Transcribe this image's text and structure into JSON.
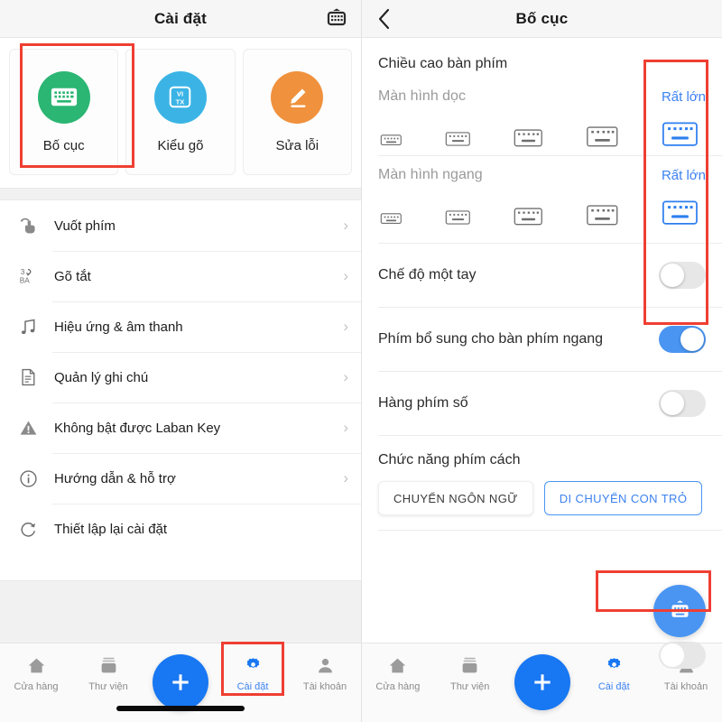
{
  "left_panel": {
    "header": {
      "title": "Cài đặt",
      "right_icon": "keyboard-popup-icon"
    },
    "cards": [
      {
        "label": "Bố cục",
        "icon": "keyboard-icon",
        "color": "#2BB673",
        "selected": true
      },
      {
        "label": "Kiểu gõ",
        "icon": "vi-tx-icon",
        "color": "#3BB4E5",
        "selected": false
      },
      {
        "label": "Sửa lỗi",
        "icon": "pencil-icon",
        "color": "#F0913D",
        "selected": false
      }
    ],
    "list": [
      {
        "label": "Vuốt phím",
        "icon": "swipe-hand-icon"
      },
      {
        "label": "Gõ tắt",
        "icon": "shortcut-3ba-icon"
      },
      {
        "label": "Hiệu ứng & âm thanh",
        "icon": "music-note-icon"
      },
      {
        "label": "Quản lý ghi chú",
        "icon": "note-document-icon"
      },
      {
        "label": "Không bật được Laban Key",
        "icon": "warning-triangle-icon"
      },
      {
        "label": "Hướng dẫn & hỗ trợ",
        "icon": "info-circle-icon"
      },
      {
        "label": "Thiết lập lại cài đặt",
        "icon": "reset-refresh-icon"
      }
    ],
    "tabbar": {
      "tabs": [
        {
          "label": "Cửa hàng",
          "icon": "home-icon",
          "active": false
        },
        {
          "label": "Thư viện",
          "icon": "library-icon",
          "active": false
        },
        {
          "label": "Cài đặt",
          "icon": "gear-icon",
          "active": true
        },
        {
          "label": "Tài khoản",
          "icon": "person-icon",
          "active": false
        }
      ],
      "fab_label": "+",
      "fab_icon": "plus-icon"
    }
  },
  "right_panel": {
    "header": {
      "title": "Bố cục",
      "back_icon": "chevron-left-icon"
    },
    "section_title": "Chiều cao bàn phím",
    "height_groups": [
      {
        "label": "Màn hình dọc",
        "value": "Rất lớn",
        "options": 5,
        "selected_index": 4
      },
      {
        "label": "Màn hình ngang",
        "value": "Rất lớn",
        "options": 5,
        "selected_index": 4
      }
    ],
    "switches": [
      {
        "label": "Chế độ một tay",
        "on": false
      },
      {
        "label": "Phím bổ sung cho bàn phím ngang",
        "on": true
      },
      {
        "label": "Hàng phím số",
        "on": false
      }
    ],
    "spacebar_section_title": "Chức năng phím cách",
    "spacebar_options": [
      {
        "label": "CHUYỂN NGÔN NGỮ",
        "selected": false
      },
      {
        "label": "DI CHUYỂN CON TRỎ",
        "selected": true
      }
    ],
    "fab_icon": "keyboard-popup-icon",
    "tabbar": {
      "tabs": [
        {
          "label": "Cửa hàng",
          "icon": "home-icon",
          "active": false
        },
        {
          "label": "Thư viện",
          "icon": "library-icon",
          "active": false
        },
        {
          "label": "Cài đặt",
          "icon": "gear-icon",
          "active": true
        },
        {
          "label": "Tài khoản",
          "icon": "person-icon",
          "active": false
        }
      ],
      "fab_icon": "plus-icon"
    }
  },
  "annotations": {
    "accent_red": "#EF3F33",
    "accent_blue": "#3D82F0",
    "boxes": [
      {
        "name": "layout-card"
      },
      {
        "name": "settings-tab"
      },
      {
        "name": "keyboard-height-values"
      },
      {
        "name": "cursor-move-chip"
      }
    ]
  }
}
